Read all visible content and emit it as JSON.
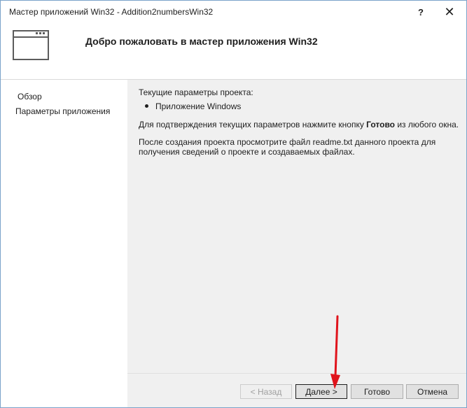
{
  "window": {
    "title": "Мастер приложений Win32 - Addition2numbersWin32",
    "help_glyph": "?",
    "close_glyph": "✕"
  },
  "header": {
    "title": "Добро пожаловать в мастер приложения Win32"
  },
  "sidebar": {
    "items": [
      {
        "label": "Обзор"
      },
      {
        "label": "Параметры приложения"
      }
    ]
  },
  "main": {
    "current_settings_label": "Текущие параметры проекта:",
    "settings_items": [
      "Приложение Windows"
    ],
    "confirm_prefix": "Для подтверждения текущих параметров нажмите кнопку ",
    "confirm_bold": "Готово",
    "confirm_suffix": " из любого окна.",
    "readme_text": "После создания проекта просмотрите файл readme.txt данного проекта для получения сведений о проекте и создаваемых файлах."
  },
  "buttons": {
    "back": "< Назад",
    "next": "Далее >",
    "finish": "Готово",
    "cancel": "Отмена"
  },
  "colors": {
    "annotation_arrow": "#e0141c",
    "content_bg": "#f0f0f0",
    "window_border": "#7aa3c9"
  }
}
